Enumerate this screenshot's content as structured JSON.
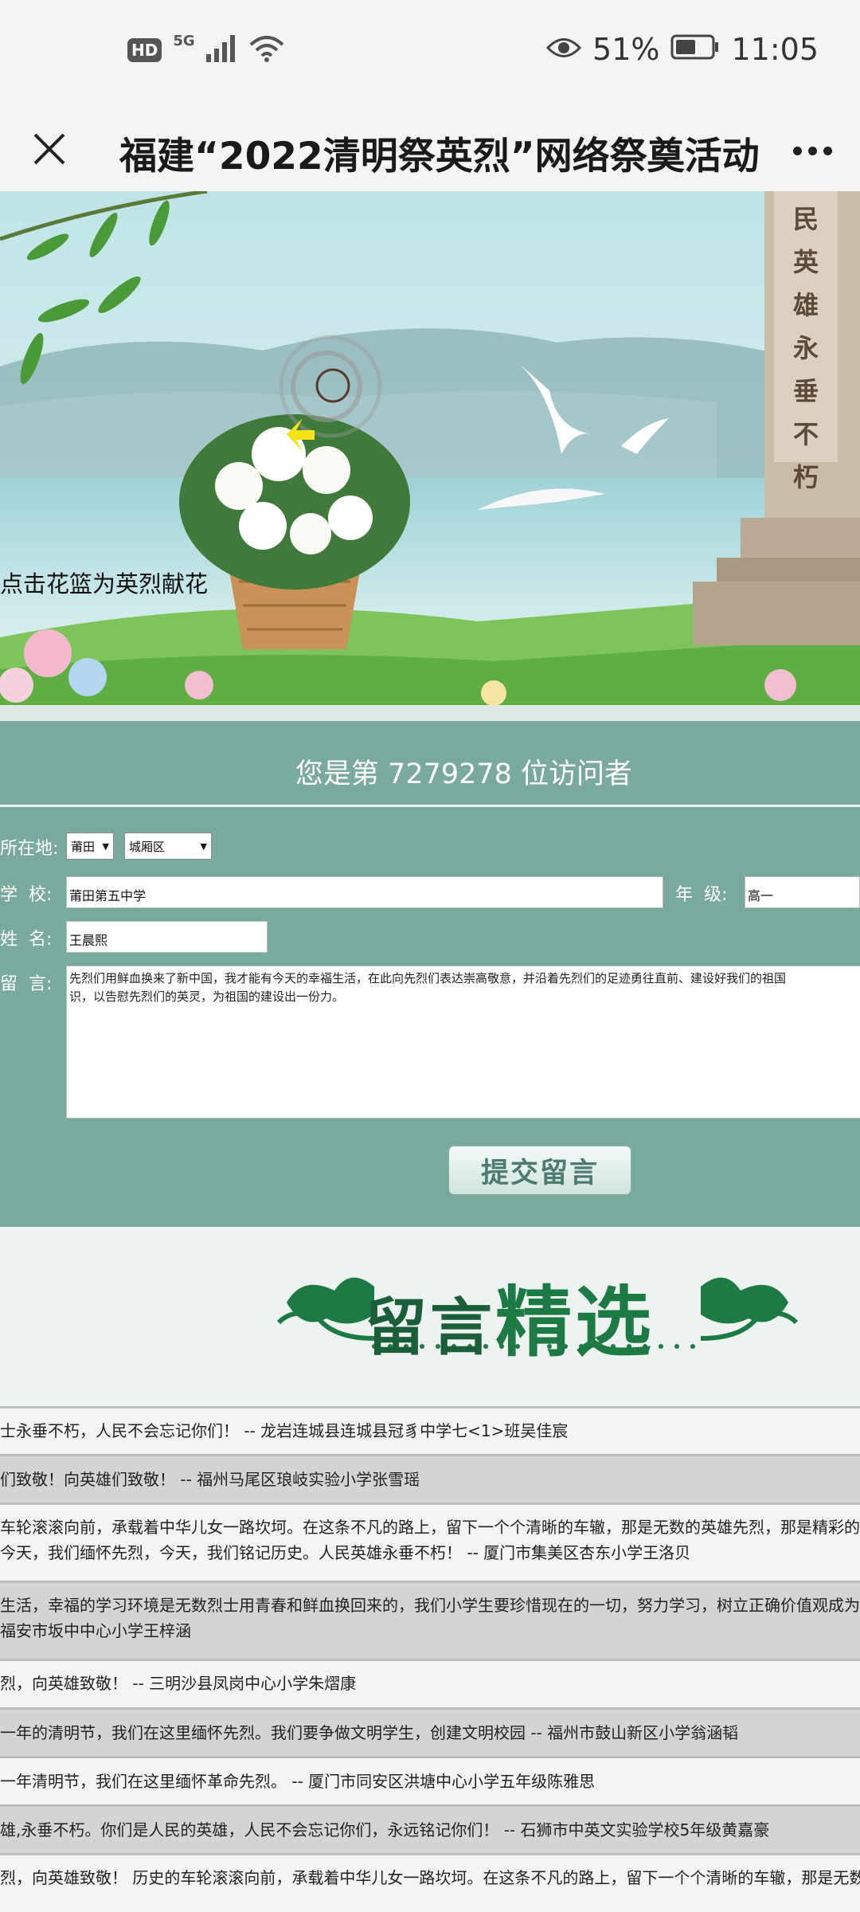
{
  "status_bar": {
    "hd": "HD",
    "network": "5G",
    "battery_percent": "51%",
    "time": "11:05"
  },
  "titlebar": {
    "title": "福建“2022清明祭英烈”网络祭奠活动"
  },
  "banner": {
    "monument_text": "民英雄永垂不朽",
    "caption": "点击花篮为英烈献花"
  },
  "form": {
    "visitor_text": "您是第 7279278 位访问者",
    "location_label": "所在地:",
    "city_value": "莆田",
    "district_value": "城厢区",
    "school_label": "学  校:",
    "school_value": "莆田第五中学",
    "grade_label": "年  级:",
    "grade_value": "高一",
    "name_label": "姓  名:",
    "name_value": "王晨熙",
    "message_label": "留  言:",
    "message_value": "先烈们用鲜血换来了新中国，我才能有今天的幸福生活，在此向先烈们表达崇高敬意，并沿着先烈们的足迹勇往直前、建设好我们的祖国，以告慰先烈们的英灵，为祖国的建设出一份力。",
    "message_line1": "先烈们用鲜血换来了新中国，我才能有今天的幸福生活，在此向先烈们表达崇高敬意，并沿着先烈们的足迹勇往直前、建设好我们的祖国",
    "message_line2": "识，以告慰先烈们的英灵，为祖国的建设出一份力。",
    "submit_label": "提交留言"
  },
  "selected": {
    "title_small": "留言",
    "title_big": "精选"
  },
  "comments": [
    {
      "lines": [
        "士永垂不朽，人民不会忘记你们！ -- 龙岩连城县连城县冠豸中学七<1>班吴佳宸"
      ]
    },
    {
      "lines": [
        "们致敬！向英雄们致敬！ -- 福州马尾区琅岐实验小学张雪瑶"
      ]
    },
    {
      "lines": [
        "车轮滚滚向前，承载着中华儿女一路坎坷。在这条不凡的路上，留下一个个清晰的车辙，那是无数的英雄先烈，那是精彩的",
        "今天，我们缅怀先烈，今天，我们铭记历史。人民英雄永垂不朽！ -- 厦门市集美区杏东小学王洛贝"
      ]
    },
    {
      "lines": [
        "生活，幸福的学习环境是无数烈士用青春和鲜血换回来的，我们小学生要珍惜现在的一切，努力学习，树立正确价值观成为",
        "福安市坂中中心小学王梓涵"
      ]
    },
    {
      "lines": [
        "烈，向英雄致敬！ -- 三明沙县凤岗中心小学朱熠康"
      ]
    },
    {
      "lines": [
        "一年的清明节，我们在这里缅怀先烈。我们要争做文明学生，创建文明校园 -- 福州市鼓山新区小学翁涵韬"
      ]
    },
    {
      "lines": [
        "一年清明节，我们在这里缅怀革命先烈。 -- 厦门市同安区洪塘中心小学五年级陈雅思"
      ]
    },
    {
      "lines": [
        "雄,永垂不朽。你们是人民的英雄，人民不会忘记你们，永远铭记你们！ -- 石狮市中英文实验学校5年级黄嘉豪"
      ]
    },
    {
      "lines": [
        "烈，向英雄致敬！ 历史的车轮滚滚向前，承载着中华儿女一路坎坷。在这条不凡的路上，留下一个个清晰的车辙，那是无数"
      ]
    }
  ]
}
